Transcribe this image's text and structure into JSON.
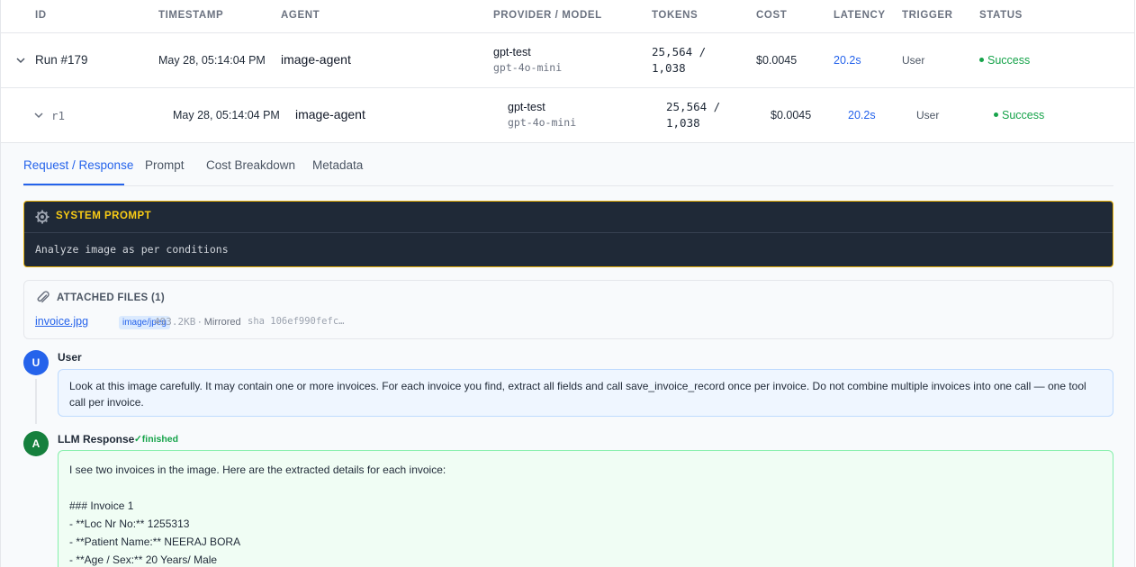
{
  "table": {
    "headers": {
      "id": "ID",
      "timestamp": "TIMESTAMP",
      "agent": "AGENT",
      "provider": "PROVIDER / MODEL",
      "tokens": "TOKENS",
      "cost": "COST",
      "latency": "LATENCY",
      "trigger": "TRIGGER",
      "status": "STATUS"
    },
    "run": {
      "id": "Run #179",
      "timestamp": "May 28, 05:14:04 PM",
      "agent": "image-agent",
      "provider": "gpt-test",
      "model": "gpt-4o-mini",
      "tokens_in": "25,564 /",
      "tokens_out": "1,038",
      "cost": "$0.0045",
      "latency": "20.2s",
      "trigger": "User",
      "status": "Success"
    },
    "subrun": {
      "id": "r1",
      "timestamp": "May 28, 05:14:04 PM",
      "agent": "image-agent",
      "provider": "gpt-test",
      "model": "gpt-4o-mini",
      "tokens_in": "25,564 /",
      "tokens_out": "1,038",
      "cost": "$0.0045",
      "latency": "20.2s",
      "trigger": "User",
      "status": "Success"
    }
  },
  "tabs": [
    "Request / Response",
    "Prompt",
    "Cost Breakdown",
    "Metadata"
  ],
  "system_prompt": {
    "title": "SYSTEM PROMPT",
    "text": "Analyze image as per conditions"
  },
  "attached_files": {
    "title": "ATTACHED FILES (1)",
    "file_name": "invoice.jpg",
    "file_type": "image/jpeg",
    "file_size": "493.2KB",
    "mirrored": "· Mirrored",
    "sha": "sha 106ef990fefc…"
  },
  "user_message": {
    "avatar": "U",
    "label": "User",
    "text": "Look at this image carefully. It may contain one or more invoices. For each invoice you find, extract all fields and call save_invoice_record once per invoice. Do not combine multiple invoices into one call — one tool call per invoice."
  },
  "llm_response": {
    "avatar": "A",
    "label": "LLM Response",
    "status": "✓finished",
    "lines": [
      "I see two invoices in the image. Here are the extracted details for each invoice:",
      "",
      "### Invoice 1",
      "- **Loc Nr No:** 1255313",
      "- **Patient Name:** NEERAJ BORA",
      "- **Age / Sex:** 20 Years/ Male"
    ]
  },
  "colors": {
    "accent": "#2563eb",
    "success": "#16a34a",
    "system_border": "#eab308",
    "system_bg": "#1f2937"
  }
}
